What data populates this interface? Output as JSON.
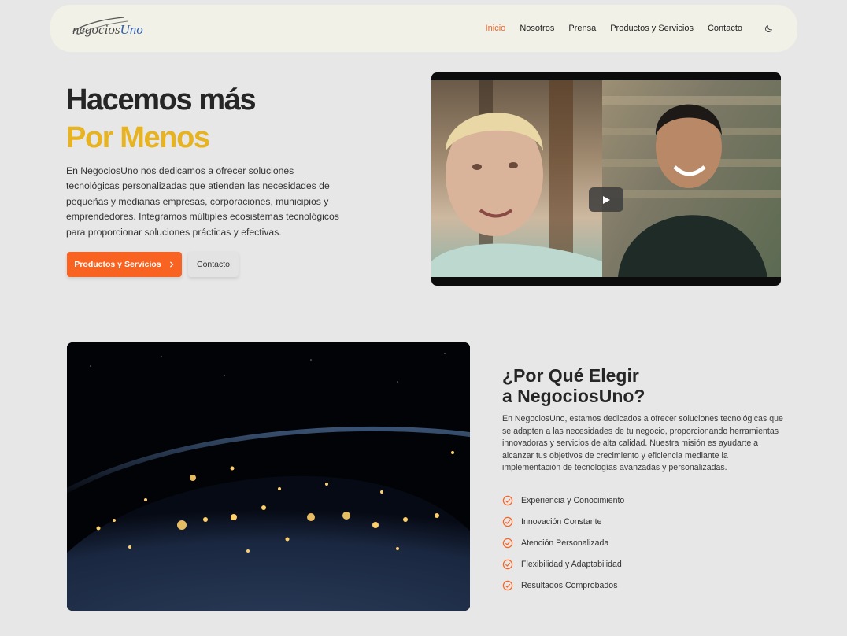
{
  "nav": {
    "logo_prefix": "negocios",
    "logo_suffix": "Uno",
    "items": [
      {
        "label": "Inicio",
        "active": true
      },
      {
        "label": "Nosotros",
        "active": false
      },
      {
        "label": "Prensa",
        "active": false
      },
      {
        "label": "Productos y Servicios",
        "active": false
      },
      {
        "label": "Contacto",
        "active": false
      }
    ],
    "theme_icon": "moon-icon"
  },
  "hero": {
    "title": "Hacemos más",
    "subtitle": "Por Menos",
    "description": "En NegociosUno nos dedicamos a ofrecer soluciones tecnológicas personalizadas que atienden las necesidades de pequeñas y medianas empresas, corporaciones, municipios y emprendedores. Integramos múltiples ecosistemas tecnológicos para proporcionar soluciones prácticas y efectivas.",
    "primary_button": "Productos y Servicios",
    "secondary_button": "Contacto"
  },
  "video": {
    "play_icon": "play-icon"
  },
  "why": {
    "title_line1": "¿Por Qué Elegir",
    "title_line2": "a NegociosUno?",
    "description": "En NegociosUno, estamos dedicados a ofrecer soluciones tecnológicas que se adapten a las necesidades de tu negocio, proporcionando herramientas innovadoras y servicios de alta calidad. Nuestra misión es ayudarte a alcanzar tus objetivos de crecimiento y eficiencia mediante la implementación de tecnologías avanzadas y personalizadas.",
    "features": [
      "Experiencia y Conocimiento",
      "Innovación Constante",
      "Atención Personalizada",
      "Flexibilidad y Adaptabilidad",
      "Resultados Comprobados"
    ]
  },
  "colors": {
    "accent": "#f96322",
    "highlight": "#e7b320",
    "nav_bg": "#f2f1e7",
    "page_bg": "#e7e7e7"
  }
}
